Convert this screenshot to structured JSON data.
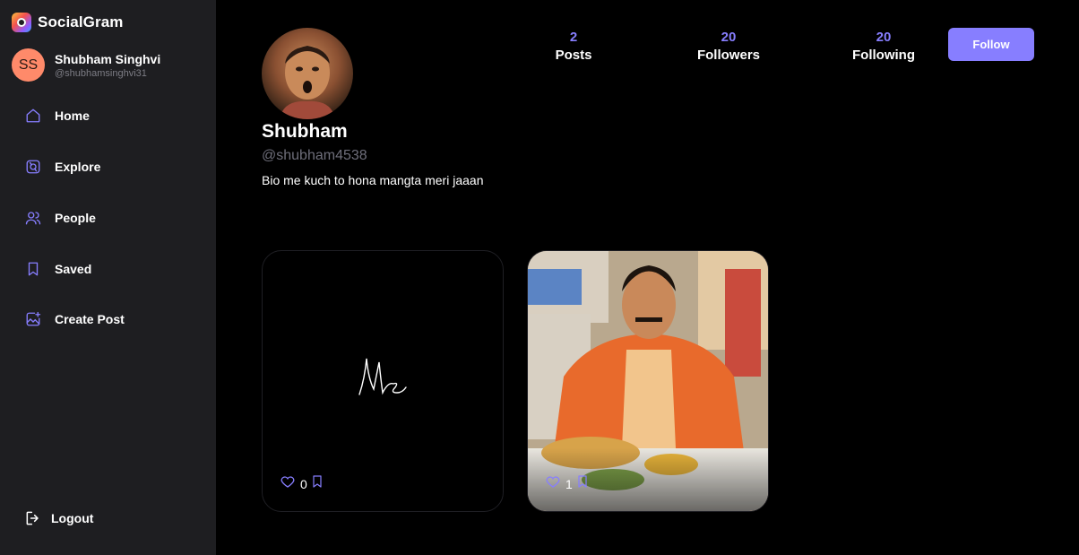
{
  "brand": {
    "name": "SocialGram"
  },
  "current_user": {
    "initials": "SS",
    "name": "Shubham Singhvi",
    "handle": "@shubhamsinghvi31"
  },
  "nav": [
    {
      "label": "Home",
      "icon": "home-icon"
    },
    {
      "label": "Explore",
      "icon": "explore-icon"
    },
    {
      "label": "People",
      "icon": "people-icon"
    },
    {
      "label": "Saved",
      "icon": "bookmark-icon"
    },
    {
      "label": "Create Post",
      "icon": "create-post-icon"
    }
  ],
  "logout": {
    "label": "Logout",
    "icon": "logout-icon"
  },
  "profile": {
    "name": "Shubham",
    "handle": "@shubham4538",
    "bio": "Bio me kuch to hona mangta meri jaaan"
  },
  "stats": [
    {
      "value": "2",
      "label": "Posts"
    },
    {
      "value": "20",
      "label": "Followers"
    },
    {
      "value": "20",
      "label": "Following"
    }
  ],
  "follow_button": {
    "label": "Follow"
  },
  "posts": [
    {
      "likes": "0",
      "image_text": "Me"
    },
    {
      "likes": "1"
    }
  ],
  "colors": {
    "accent": "#877eff",
    "sidebar": "#1e1e21",
    "background": "#000000"
  }
}
